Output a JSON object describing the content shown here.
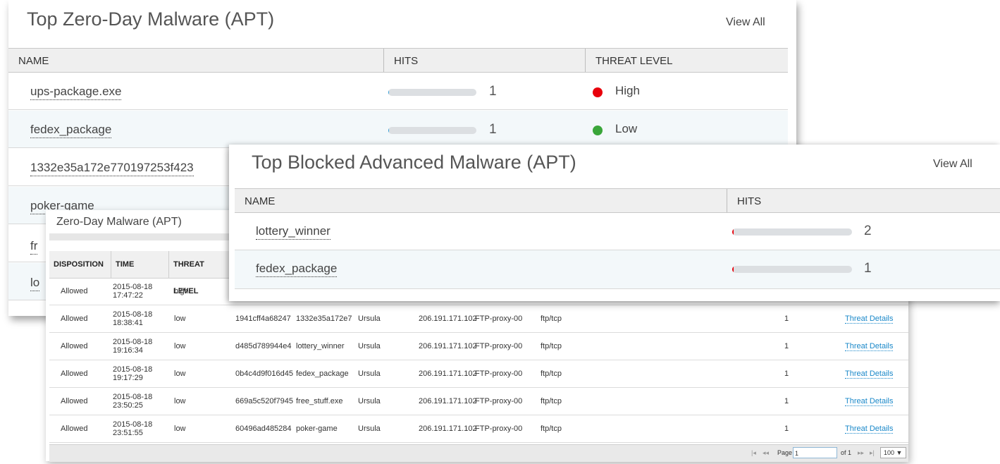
{
  "zero_day_panel": {
    "title": "Top Zero-Day Malware (APT)",
    "view_all": "View All",
    "columns": [
      "NAME",
      "HITS",
      "THREAT LEVEL"
    ],
    "rows": [
      {
        "name": "ups-package.exe",
        "hits": "1",
        "level": "High",
        "level_color": "#e8000b"
      },
      {
        "name": "fedex_package",
        "hits": "1",
        "level": "Low",
        "level_color": "#3aa63a"
      },
      {
        "name": "1332e35a172e770197253f423"
      },
      {
        "name": "poker-game"
      },
      {
        "name": "fr"
      },
      {
        "name": "lo"
      }
    ]
  },
  "blocked_panel": {
    "title": "Top Blocked Advanced Malware (APT)",
    "view_all": "View All",
    "columns": [
      "NAME",
      "HITS"
    ],
    "rows": [
      {
        "name": "lottery_winner",
        "hits": "2"
      },
      {
        "name": "fedex_package",
        "hits": "1"
      }
    ],
    "bar_color": "#e8000b"
  },
  "detail_panel": {
    "title": "Zero-Day Malware (APT)",
    "columns": [
      "DISPOSITION",
      "TIME",
      "THREAT LEVEL"
    ],
    "rows": [
      {
        "disposition": "Allowed",
        "date": "2015-08-18",
        "time": "17:47:22",
        "level": "high",
        "hash": "",
        "file": "",
        "user": "",
        "ip": "",
        "proxy": "",
        "protocol": "",
        "hits": "",
        "link": ""
      },
      {
        "disposition": "Allowed",
        "date": "2015-08-18",
        "time": "18:38:41",
        "level": "low",
        "hash": "1941cff4a68247",
        "file": "1332e35a172e7",
        "user": "Ursula",
        "ip": "206.191.171.102",
        "proxy": "FTP-proxy-00",
        "protocol": "ftp/tcp",
        "hits": "1",
        "link": "Threat Details"
      },
      {
        "disposition": "Allowed",
        "date": "2015-08-18",
        "time": "19:16:34",
        "level": "low",
        "hash": "d485d789944e4",
        "file": "lottery_winner",
        "user": "Ursula",
        "ip": "206.191.171.102",
        "proxy": "FTP-proxy-00",
        "protocol": "ftp/tcp",
        "hits": "1",
        "link": "Threat Details"
      },
      {
        "disposition": "Allowed",
        "date": "2015-08-18",
        "time": "19:17:29",
        "level": "low",
        "hash": "0b4c4d9f016d45",
        "file": "fedex_package",
        "user": "Ursula",
        "ip": "206.191.171.102",
        "proxy": "FTP-proxy-00",
        "protocol": "ftp/tcp",
        "hits": "1",
        "link": "Threat Details"
      },
      {
        "disposition": "Allowed",
        "date": "2015-08-18",
        "time": "23:50:25",
        "level": "low",
        "hash": "669a5c520f7945",
        "file": "free_stuff.exe",
        "user": "Ursula",
        "ip": "206.191.171.102",
        "proxy": "FTP-proxy-00",
        "protocol": "ftp/tcp",
        "hits": "1",
        "link": "Threat Details"
      },
      {
        "disposition": "Allowed",
        "date": "2015-08-18",
        "time": "23:51:55",
        "level": "low",
        "hash": "60496ad485284",
        "file": "poker-game",
        "user": "Ursula",
        "ip": "206.191.171.102",
        "proxy": "FTP-proxy-00",
        "protocol": "ftp/tcp",
        "hits": "1",
        "link": "Threat Details"
      }
    ],
    "pager": {
      "first": "|◂",
      "prev": "◂◂",
      "page_label": "Page",
      "page_value": "1",
      "of_label": "of 1",
      "next": "▸▸",
      "last": "▸|",
      "page_size": "100 ▼"
    }
  }
}
